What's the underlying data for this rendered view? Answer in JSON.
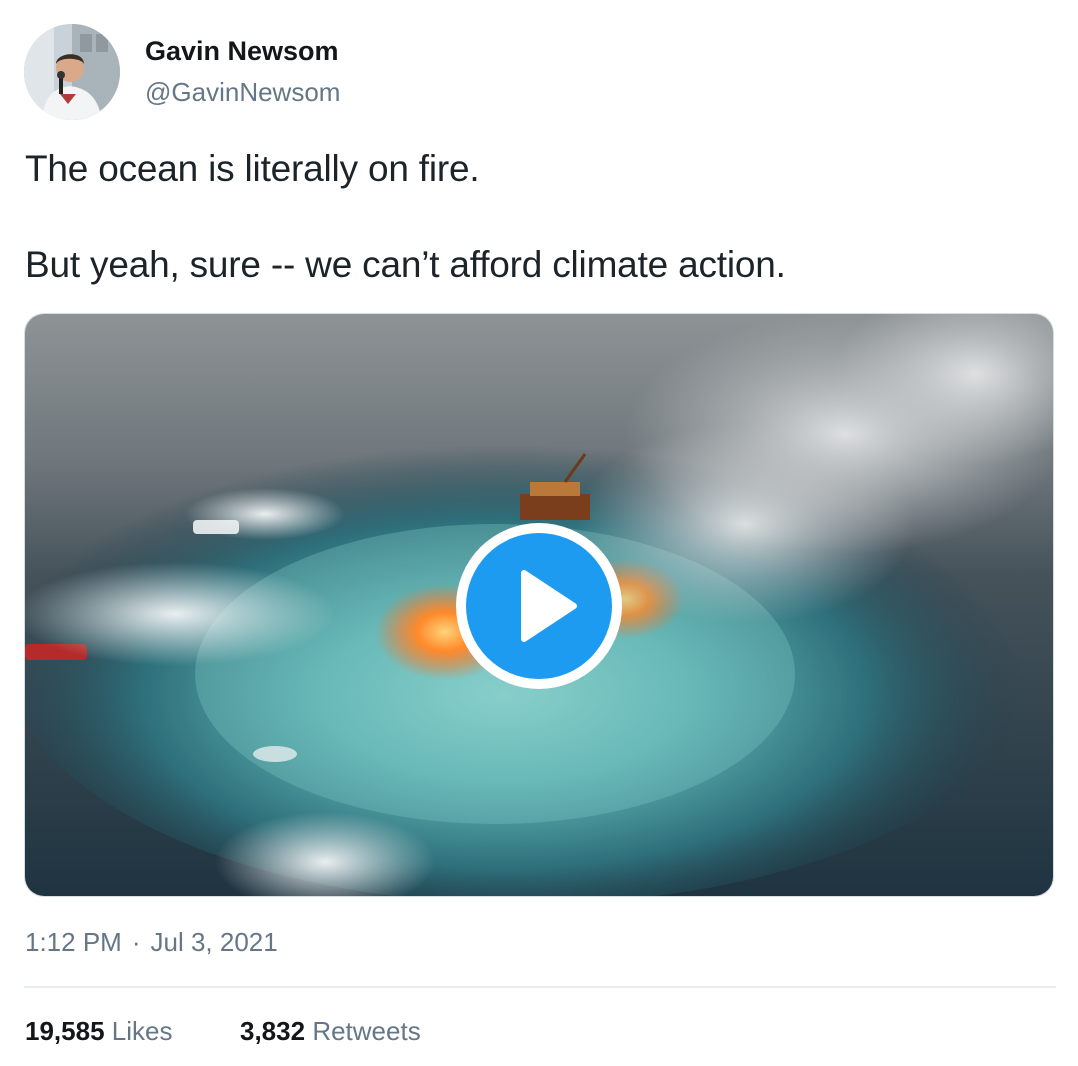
{
  "author": {
    "display_name": "Gavin Newsom",
    "handle": "@GavinNewsom",
    "avatar_icon": "profile-photo"
  },
  "tweet": {
    "lines": [
      "The ocean is literally on fire.",
      "But yeah, sure -- we can’t afford climate action."
    ]
  },
  "media": {
    "type": "video",
    "play_icon": "play-icon",
    "accent_color": "#1d9bf0"
  },
  "meta": {
    "time": "1:12 PM",
    "separator": "·",
    "date": "Jul 3, 2021"
  },
  "stats": {
    "likes_count": "19,585",
    "likes_label": "Likes",
    "retweets_count": "3,832",
    "retweets_label": "Retweets"
  }
}
